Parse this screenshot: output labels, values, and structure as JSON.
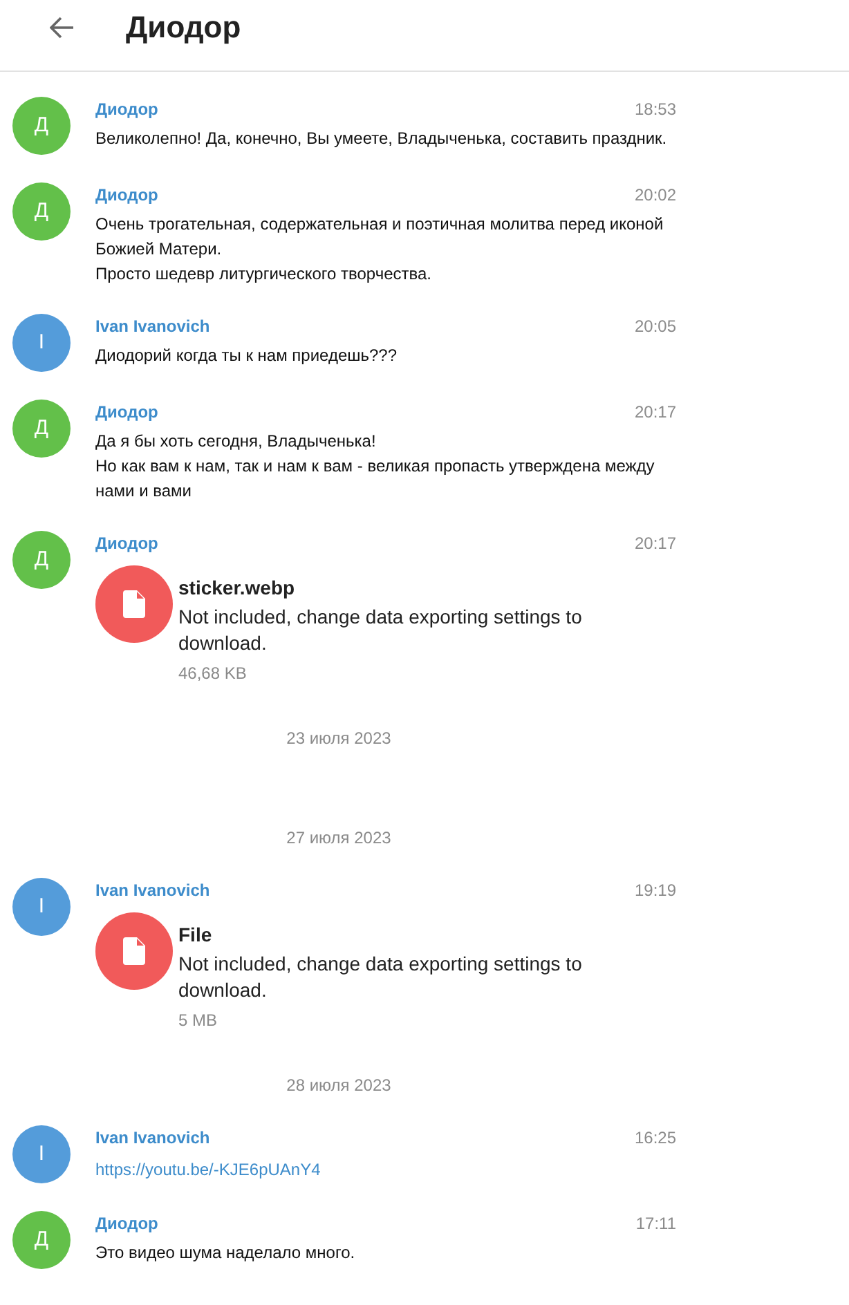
{
  "header": {
    "title": "Диодор"
  },
  "items": [
    {
      "kind": "text",
      "avatar": "Д",
      "color": "#63c04a",
      "name": "Диодор",
      "time": "18:53",
      "text": "Великолепно! Да, конечно, Вы умеете, Владыченька, составить праздник."
    },
    {
      "kind": "text",
      "avatar": "Д",
      "color": "#63c04a",
      "name": "Диодор",
      "time": "20:02",
      "text": "Очень трогательная, содержательная и поэтичная молитва перед иконой Божией Матери.\nПросто шедевр литургического творчества."
    },
    {
      "kind": "text",
      "avatar": "I",
      "color": "#549cda",
      "name": "Ivan Ivanovich",
      "time": "20:05",
      "text": "Диодорий когда ты к нам приедешь???"
    },
    {
      "kind": "text",
      "avatar": "Д",
      "color": "#63c04a",
      "name": "Диодор",
      "time": "20:17",
      "text": "Да я бы хоть сегодня, Владыченька!\nНо как вам к нам, так и нам к вам - великая пропасть утверждена между нами и вами"
    },
    {
      "kind": "file",
      "avatar": "Д",
      "color": "#63c04a",
      "name": "Диодор",
      "time": "20:17",
      "file_name": "sticker.webp",
      "note": "Not included, change data exporting settings to download.",
      "size": "46,68 KB"
    },
    {
      "kind": "date",
      "text": "23 июля 2023"
    },
    {
      "kind": "date",
      "text": "27 июля 2023"
    },
    {
      "kind": "file",
      "avatar": "I",
      "color": "#549cda",
      "name": "Ivan Ivanovich",
      "time": "19:19",
      "file_name": "File",
      "note": "Not included, change data exporting settings to download.",
      "size": "5 MB"
    },
    {
      "kind": "date",
      "text": "28 июля 2023"
    },
    {
      "kind": "link",
      "avatar": "I",
      "color": "#549cda",
      "name": "Ivan Ivanovich",
      "time": "16:25",
      "text": "https://youtu.be/-KJE6pUAnY4"
    },
    {
      "kind": "text",
      "avatar": "Д",
      "color": "#63c04a",
      "name": "Диодор",
      "time": "17:11",
      "text": "Это видео шума наделало много."
    }
  ]
}
